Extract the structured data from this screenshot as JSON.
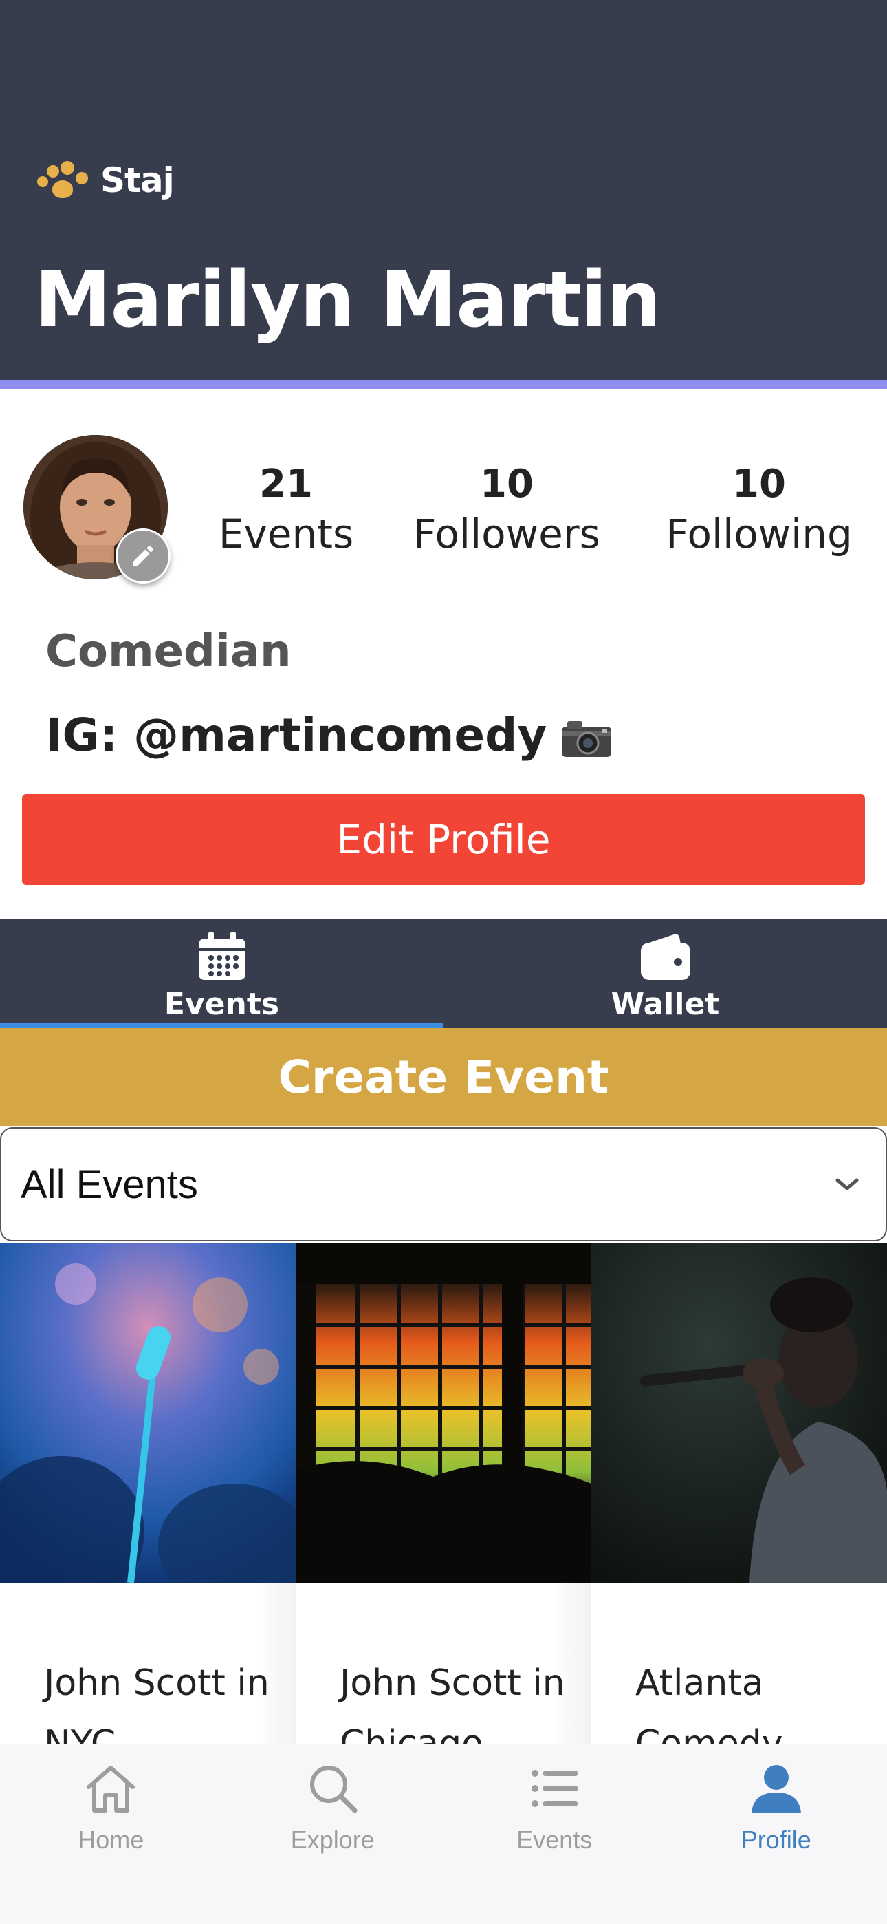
{
  "header": {
    "brand": "Staj",
    "title": "Marilyn Martin",
    "colors": {
      "background": "#373d4d",
      "accent_line": "#8d8ef0",
      "brand_dots": "#e7b04a"
    }
  },
  "profile": {
    "stats": [
      {
        "value": "21",
        "label": "Events"
      },
      {
        "value": "10",
        "label": "Followers"
      },
      {
        "value": "10",
        "label": "Following"
      }
    ],
    "role": "Comedian",
    "bio": "IG: @martincomedy",
    "bio_icon": "camera-emoji",
    "edit_button": "Edit Profile"
  },
  "tabs": [
    {
      "label": "Events",
      "icon": "calendar-icon",
      "active": true
    },
    {
      "label": "Wallet",
      "icon": "wallet-icon",
      "active": false
    }
  ],
  "create_event_label": "Create Event",
  "filter": {
    "selected": "All Events"
  },
  "events": [
    {
      "title": "John Scott in NYC"
    },
    {
      "title": "John Scott in Chicago"
    },
    {
      "title": "Atlanta Comedy"
    }
  ],
  "bottom_nav": [
    {
      "label": "Home",
      "icon": "home-icon",
      "active": false
    },
    {
      "label": "Explore",
      "icon": "search-icon",
      "active": false
    },
    {
      "label": "Events",
      "icon": "list-icon",
      "active": false
    },
    {
      "label": "Profile",
      "icon": "person-icon",
      "active": true
    }
  ],
  "colors": {
    "edit_button": "#f24535",
    "create_event": "#d4a644",
    "tab_indicator": "#3d8de0",
    "nav_active": "#3f7fc0",
    "nav_inactive": "#9d9d9d"
  }
}
